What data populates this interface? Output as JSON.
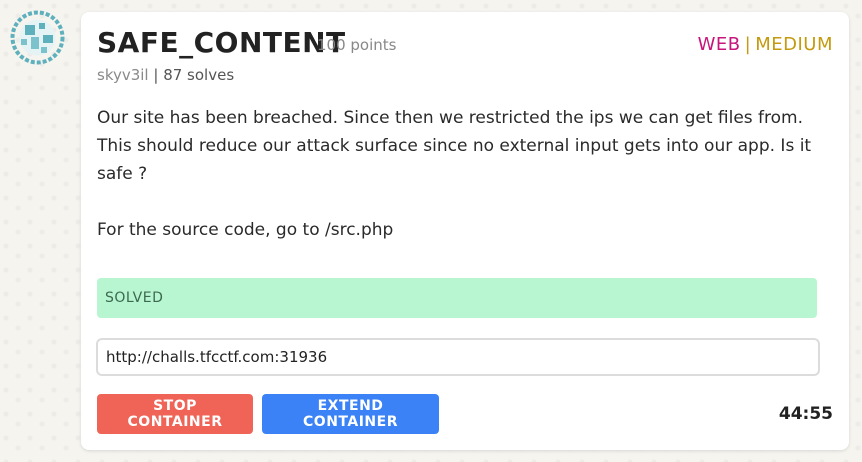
{
  "challenge": {
    "title": "SAFE_CONTENT",
    "points": "100 points",
    "author": "skyv3il",
    "separator": " | ",
    "solves": "87 solves",
    "category": "WEB",
    "tag_separator": "|",
    "difficulty": "MEDIUM",
    "description_p1": "Our site has been breached. Since then we restricted the ips we can get files from. This should reduce our attack surface since no external input gets into our app. Is it safe ?",
    "description_p2": "For the source code, go to /src.php",
    "status": "SOLVED"
  },
  "instance": {
    "url": "http://challs.tfcctf.com:31936",
    "stop_label": "STOP CONTAINER",
    "extend_label": "EXTEND CONTAINER",
    "timer": "44:55"
  },
  "colors": {
    "category": "#c8157c",
    "difficulty": "#c49a10",
    "solved_bg": "#b8f5d1",
    "stop_btn": "#f06458",
    "extend_btn": "#3b82f6"
  },
  "icons": {
    "avatar": "team-globe-avatar-icon"
  }
}
